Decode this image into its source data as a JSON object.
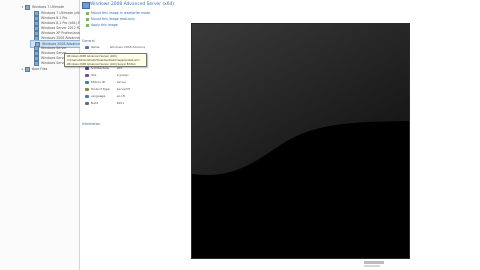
{
  "tree": {
    "items": [
      {
        "label": "Windows 7 Ultimate",
        "expander": "▾",
        "level": 0
      },
      {
        "label": "Windows 7 Ultimate (x64)",
        "expander": "",
        "level": 1
      },
      {
        "label": "Windows 8.1 Pro",
        "expander": "",
        "level": 1
      },
      {
        "label": "Windows 8.1 Pro (x64) Edition",
        "expander": "",
        "level": 1
      },
      {
        "label": "Windows Server 2012 R2 (x64)",
        "expander": "",
        "level": 1
      },
      {
        "label": "Windows XP Professional",
        "expander": "",
        "level": 1
      },
      {
        "label": "Windows 2008 Advanced Server",
        "expander": "",
        "level": 1
      },
      {
        "label": "Windows 2008 Advanced Server (x64)",
        "expander": "",
        "level": 1
      },
      {
        "label": "Windows Server",
        "expander": "",
        "level": 1
      },
      {
        "label": "Windows Server",
        "expander": "",
        "level": 1
      },
      {
        "label": "Windows Server",
        "expander": "",
        "level": 1
      },
      {
        "label": "Windows Server",
        "expander": "",
        "level": 1
      },
      {
        "label": "Boot Files",
        "expander": "▸",
        "level": 0
      }
    ],
    "selected_index": 7
  },
  "tooltip": {
    "lines": [
      "Windows 2008 Advanced Server (x64)",
      "C:\\Users\\Administrator\\Desktop\\Disk\\Images\\install.wim",
      "Windows 2008 Advanced Server (x64) Server Edition"
    ]
  },
  "props": {
    "title": "Windows 2008 Advanced Server (x64)",
    "links": [
      "Mount this image in read/write mode",
      "Mount this image read-only",
      "Apply this image"
    ],
    "section_general": "General",
    "rows": [
      {
        "name": "Name",
        "value": "Windows 2008 Advanced Server",
        "color": "#4a78b5"
      },
      {
        "name": "Description",
        "value": "Advanced Server",
        "color": "#6a8f4a"
      },
      {
        "name": "Flags",
        "value": "Server",
        "color": "#b07a3a"
      },
      {
        "name": "Architecture",
        "value": "x64",
        "color": "#4a4a9a"
      },
      {
        "name": "HAL",
        "value": "acpiapic",
        "color": "#7a4a8a"
      },
      {
        "name": "Edition ID",
        "value": "Server",
        "color": "#3a8a8a"
      },
      {
        "name": "Product Type",
        "value": "ServerNT",
        "color": "#8a8a3a"
      },
      {
        "name": "Language",
        "value": "en-US",
        "color": "#4a78b5"
      },
      {
        "name": "Build",
        "value": "6001",
        "color": "#6a6a6a"
      }
    ],
    "section_information": "Information"
  },
  "preview": {
    "gradient_top": "#3a3a3a",
    "gradient_bottom": "#0a0a0a",
    "wave_color": "#000000"
  }
}
